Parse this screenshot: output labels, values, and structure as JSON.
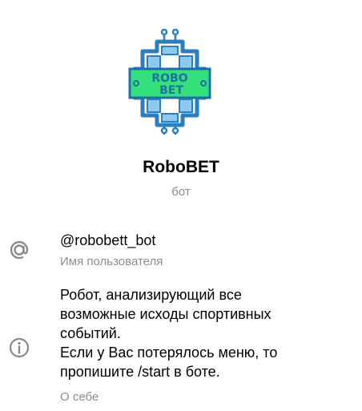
{
  "profile": {
    "avatar_icon": "robobet-chip-logo",
    "avatar_text": [
      "ROBO",
      "BET"
    ],
    "name": "RoboBET",
    "subtitle": "бот"
  },
  "username": {
    "icon": "at-sign-icon",
    "value": "@robobett_bot",
    "caption": "Имя пользователя"
  },
  "about": {
    "icon": "info-icon",
    "lines": [
      "Робот, анализирующий все",
      "возможные исходы спортивных",
      "событий.",
      "Если у Вас потерялось меню, то",
      "пропишите /start в боте."
    ],
    "caption": "О себе"
  },
  "colors": {
    "chip_green": "#34e07a",
    "chip_blue": "#2a7fc1",
    "text_secondary": "#8d8d8d",
    "icon_gray": "#8a8a8a"
  }
}
